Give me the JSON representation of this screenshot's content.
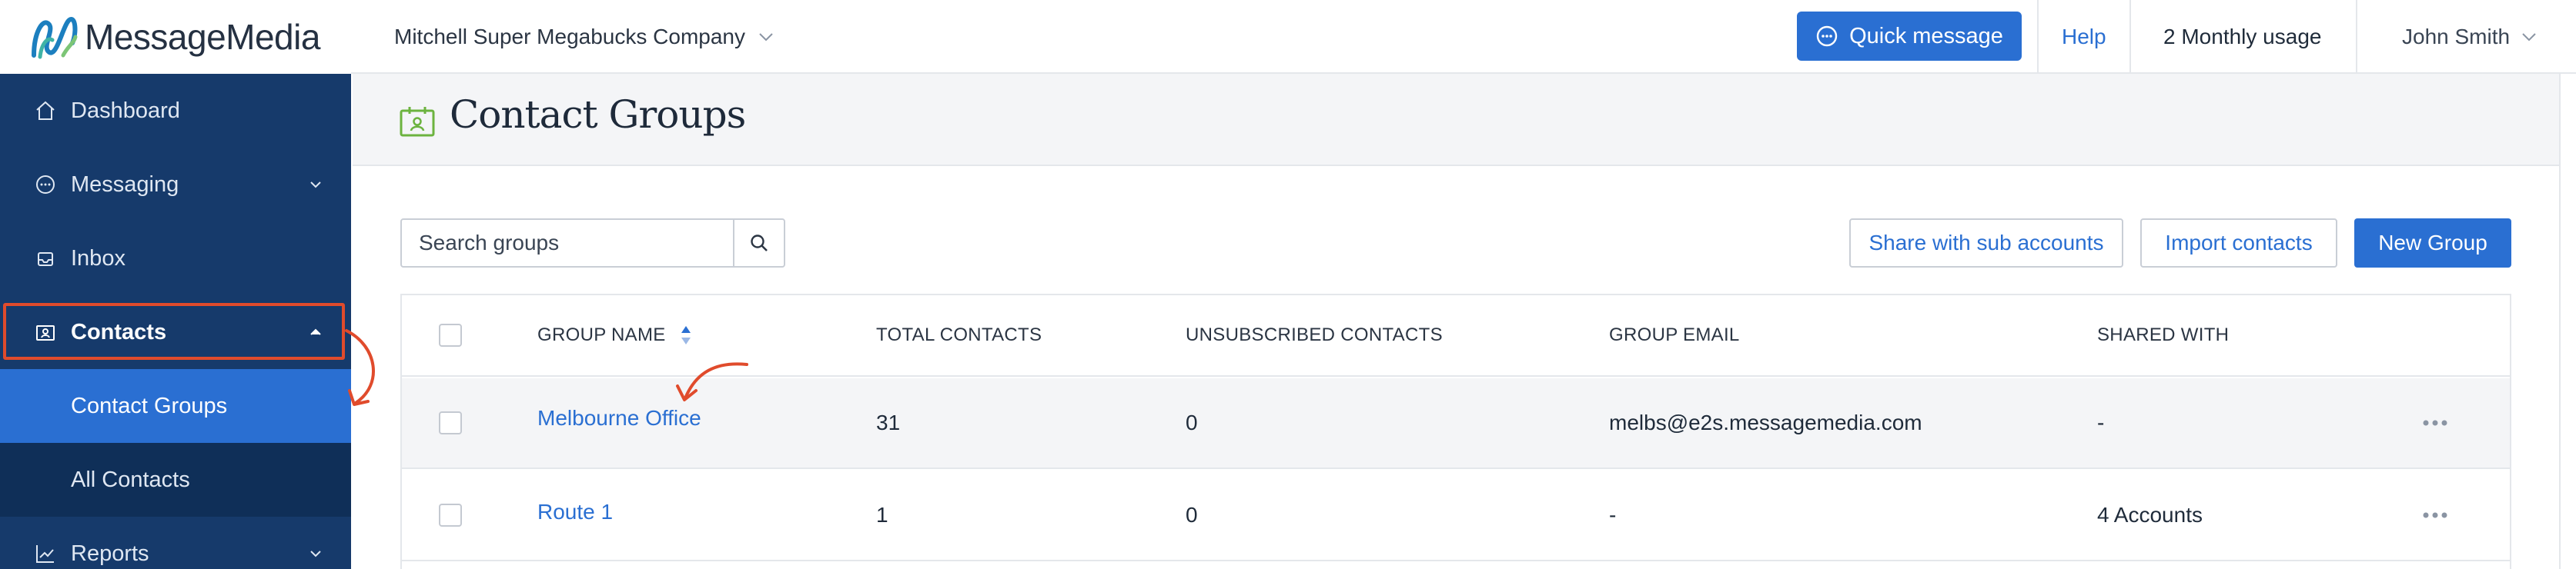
{
  "brand": {
    "name": "MessageMedia"
  },
  "topbar": {
    "account": "Mitchell Super Megabucks Company",
    "quick_message": "Quick message",
    "help": "Help",
    "usage": "2 Monthly usage",
    "user": "John Smith"
  },
  "sidebar": {
    "items": [
      {
        "label": "Dashboard",
        "icon": "home-icon"
      },
      {
        "label": "Messaging",
        "icon": "chat-icon"
      },
      {
        "label": "Inbox",
        "icon": "inbox-icon"
      },
      {
        "label": "Contacts",
        "icon": "contacts-icon"
      },
      {
        "label": "Reports",
        "icon": "chart-icon"
      }
    ],
    "sub_items": [
      {
        "label": "Contact Groups",
        "selected": true
      },
      {
        "label": "All Contacts",
        "selected": false
      }
    ]
  },
  "page": {
    "title": "Contact Groups"
  },
  "toolbar": {
    "search_placeholder": "Search groups",
    "share": "Share with sub accounts",
    "import": "Import contacts",
    "new_group": "New Group"
  },
  "table": {
    "columns": [
      "GROUP NAME",
      "TOTAL CONTACTS",
      "UNSUBSCRIBED CONTACTS",
      "GROUP EMAIL",
      "SHARED WITH"
    ],
    "rows": [
      {
        "name": "Melbourne Office",
        "total": "31",
        "unsubscribed": "0",
        "email": "melbs@e2s.messagemedia.com",
        "shared": "-"
      },
      {
        "name": "Route 1",
        "total": "1",
        "unsubscribed": "0",
        "email": "-",
        "shared": "4 Accounts"
      }
    ]
  },
  "colors": {
    "sidebar": "#163a6b",
    "accent": "#2a6fd2",
    "annotation": "#e04b2c"
  }
}
